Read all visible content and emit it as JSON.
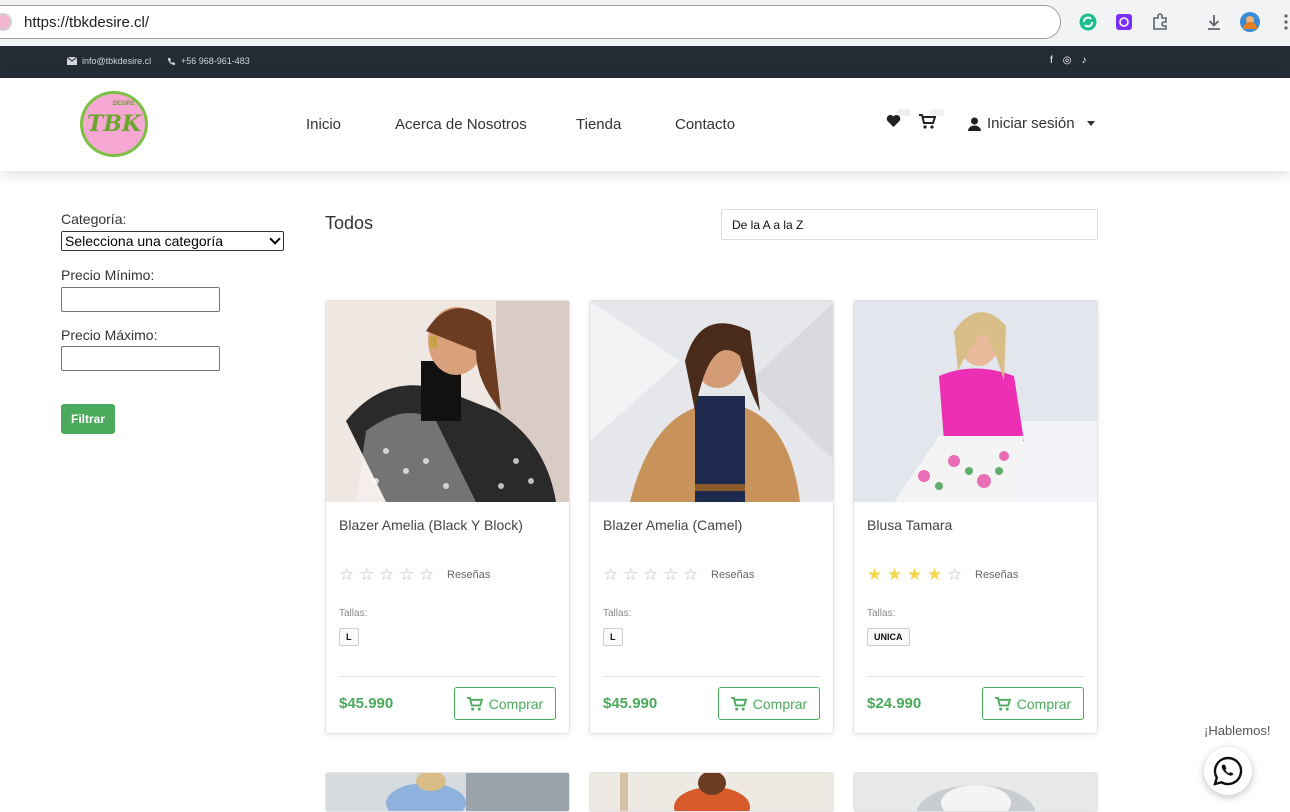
{
  "browser": {
    "url": "https://tbkdesire.cl/"
  },
  "topbar": {
    "email": "info@tbkdesire.cl",
    "phone": "+56 968-961-483",
    "social": [
      "f",
      "◎",
      "♪"
    ]
  },
  "header": {
    "logo_text": "TBK",
    "logo_sub": "DESIRE",
    "nav": [
      "Inicio",
      "Acerca de Nosotros",
      "Tienda",
      "Contacto"
    ],
    "login_label": "Iniciar sesión"
  },
  "filters": {
    "category_label": "Categoría:",
    "category_selected": "Selecciona una categoría",
    "min_price_label": "Precio Mínimo:",
    "max_price_label": "Precio Máximo:",
    "filter_button": "Filtrar"
  },
  "main": {
    "heading": "Todos",
    "sort_selected": "De la A a la Z",
    "products": [
      {
        "name": "Blazer Amelia (Black Y Block)",
        "rating": 0,
        "reviews_label": "Reseñas",
        "sizes_label": "Tallas:",
        "size": "L",
        "price": "$45.990",
        "buy_label": "Comprar"
      },
      {
        "name": "Blazer Amelia (Camel)",
        "rating": 0,
        "reviews_label": "Reseñas",
        "sizes_label": "Tallas:",
        "size": "L",
        "price": "$45.990",
        "buy_label": "Comprar"
      },
      {
        "name": "Blusa Tamara",
        "rating": 4,
        "reviews_label": "Reseñas",
        "sizes_label": "Tallas:",
        "size": "UNICA",
        "price": "$24.990",
        "buy_label": "Comprar"
      }
    ]
  },
  "chat": {
    "label": "¡Hablemos!"
  },
  "colors": {
    "accent": "#4caa5c",
    "topbar": "#232b35",
    "star_filled": "#f2d649",
    "star_empty": "#bdbdbd"
  }
}
